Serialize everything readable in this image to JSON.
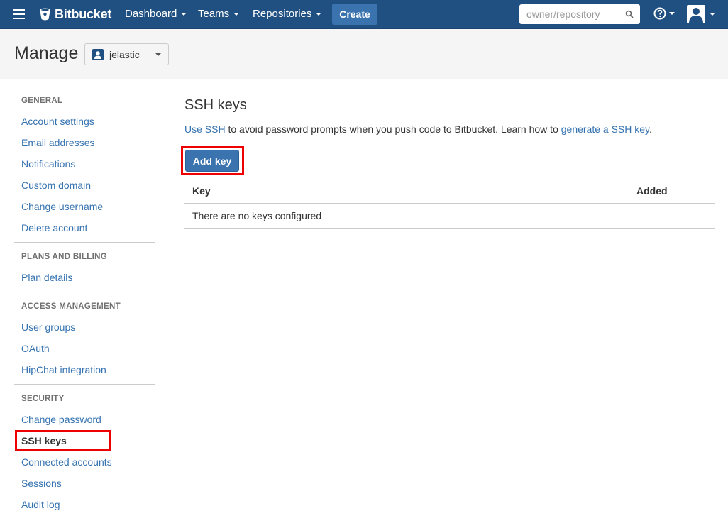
{
  "topbar": {
    "logo_text": "Bitbucket",
    "nav": [
      {
        "label": "Dashboard"
      },
      {
        "label": "Teams"
      },
      {
        "label": "Repositories"
      }
    ],
    "create_label": "Create",
    "search_placeholder": "owner/repository",
    "brand_color": "#205081",
    "button_color": "#3b73af"
  },
  "header": {
    "title": "Manage",
    "account_name": "jelastic"
  },
  "sidebar": {
    "sections": [
      {
        "heading": "GENERAL",
        "items": [
          "Account settings",
          "Email addresses",
          "Notifications",
          "Custom domain",
          "Change username",
          "Delete account"
        ]
      },
      {
        "heading": "PLANS AND BILLING",
        "items": [
          "Plan details"
        ]
      },
      {
        "heading": "ACCESS MANAGEMENT",
        "items": [
          "User groups",
          "OAuth",
          "HipChat integration"
        ]
      },
      {
        "heading": "SECURITY",
        "items": [
          "Change password",
          "SSH keys",
          "Connected accounts",
          "Sessions",
          "Audit log"
        ]
      }
    ],
    "active_item": "SSH keys"
  },
  "main": {
    "title": "SSH keys",
    "intro": {
      "link1": "Use SSH",
      "text1": " to avoid password prompts when you push code to Bitbucket. Learn how to ",
      "link2": "generate a SSH key",
      "text2": "."
    },
    "add_key_label": "Add key",
    "table": {
      "columns": [
        "Key",
        "Added"
      ],
      "empty_message": "There are no keys configured"
    }
  },
  "annotation_color": "#ee0000"
}
